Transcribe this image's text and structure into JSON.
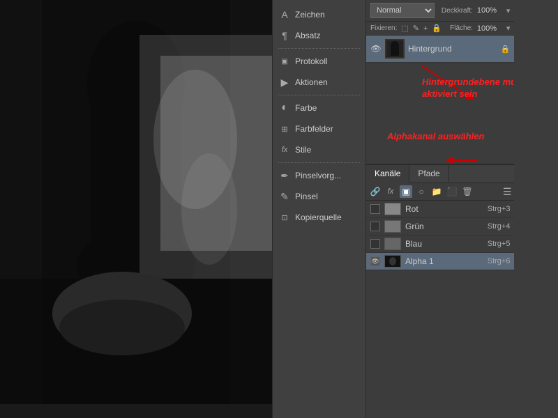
{
  "image": {
    "description": "Black and white photo of dark sculpture/object"
  },
  "panels": {
    "items": [
      {
        "id": "zeichen",
        "label": "Zeichen",
        "icon": "A"
      },
      {
        "id": "absatz",
        "label": "Absatz",
        "icon": "¶"
      },
      {
        "id": "protokoll",
        "label": "Protokoll",
        "icon": "◫"
      },
      {
        "id": "aktionen",
        "label": "Aktionen",
        "icon": "▶"
      },
      {
        "id": "farbe",
        "label": "Farbe",
        "icon": "○"
      },
      {
        "id": "farbfelder",
        "label": "Farbfelder",
        "icon": "⊞"
      },
      {
        "id": "stile",
        "label": "Stile",
        "icon": "fx"
      },
      {
        "id": "pinselvorgaben",
        "label": "Pinselvorg...",
        "icon": "✒"
      },
      {
        "id": "pinsel",
        "label": "Pinsel",
        "icon": "✎"
      },
      {
        "id": "kopierquelle",
        "label": "Kopierquelle",
        "icon": "⊡"
      }
    ]
  },
  "layers_panel": {
    "blend_mode": "Normal",
    "opacity_label": "Deckkraft:",
    "opacity_value": "100%",
    "fill_label": "Fläche:",
    "fill_value": "100%",
    "lock_label": "Fixieren:",
    "layers": [
      {
        "id": "hintergrund",
        "name": "Hintergrund",
        "visible": true,
        "locked": true,
        "active": true
      }
    ],
    "annotation1_text": "Hintergrundebene muss aktiviert sein"
  },
  "channels_panel": {
    "tabs": [
      {
        "id": "kanaele",
        "label": "Kanäle",
        "active": true
      },
      {
        "id": "pfade",
        "label": "Pfade",
        "active": false
      }
    ],
    "channels": [
      {
        "id": "rot",
        "name": "Rot",
        "shortcut": "Strg+3",
        "visible": false,
        "thumb_color": "#888"
      },
      {
        "id": "gruen",
        "name": "Grün",
        "shortcut": "Strg+4",
        "visible": false,
        "thumb_color": "#777"
      },
      {
        "id": "blau",
        "name": "Blau",
        "shortcut": "Strg+5",
        "visible": false,
        "thumb_color": "#666"
      },
      {
        "id": "alpha1",
        "name": "Alpha 1",
        "shortcut": "Strg+6",
        "visible": true,
        "thumb_color": "#333",
        "active": true
      }
    ],
    "annotation2_text": "Alphakanal auswählen"
  },
  "colors": {
    "accent": "#ff2020",
    "active_layer_bg": "#5a6a7a",
    "panel_bg": "#3c3c3c",
    "panel_dark": "#404040"
  }
}
